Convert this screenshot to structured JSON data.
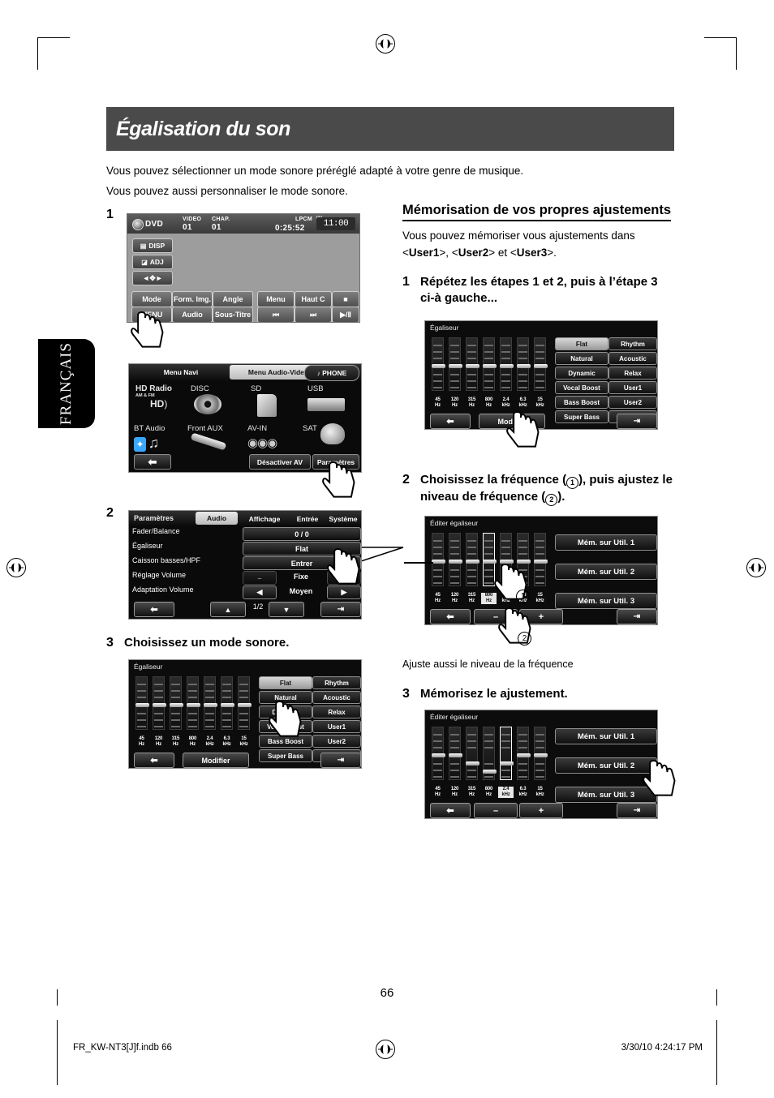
{
  "page": {
    "title": "Égalisation du son",
    "intro_line1": "Vous pouvez sélectionner un mode sonore préréglé adapté à votre genre de musique.",
    "intro_line2": "Vous pouvez aussi personnaliser le mode sonore.",
    "language_tab": "FRANÇAIS",
    "page_number": "66",
    "footer_left": "FR_KW-NT3[J]f.indb   66",
    "footer_right": "3/30/10   4:24:17 PM"
  },
  "left_column": {
    "step1_num": "1",
    "step2_num": "2",
    "step3_num": "3",
    "step3_text": "Choisissez un mode sonore."
  },
  "right_column": {
    "heading": "Mémorisation de vos propres ajustements",
    "intro_a": "Vous pouvez mémoriser vous ajustements dans",
    "intro_b_pre": "<",
    "intro_user1": "User1",
    "intro_b_mid": ">, <",
    "intro_user2": "User2",
    "intro_b_mid2": "> et <",
    "intro_user3": "User3",
    "intro_b_end": ">.",
    "step1_num": "1",
    "step1_text_l1": "Répétez les étapes 1 et 2, puis à l’étape 3",
    "step1_text_l2": "ci-à gauche...",
    "step2_num": "2",
    "step2_text_l1": "Choisissez la fréquence (",
    "step2_text_l1b": "), puis ajustez le",
    "step2_text_l2": "niveau de fréquence (",
    "step2_text_l2b": ").",
    "note": "Ajuste aussi le niveau de la fréquence",
    "step3_num": "3",
    "step3_text": "Mémorisez le ajustement.",
    "callout1": "1",
    "callout2": "2"
  },
  "dvd_screen": {
    "source": "DVD",
    "video_label": "VIDEO",
    "video_value": "01",
    "chap_label": "CHAP.",
    "chap_value": "01",
    "format": "LPCM",
    "time": "0:25:52",
    "clock": "11:00",
    "pm": "PM",
    "side_buttons": [
      "DISP",
      "ADJ"
    ],
    "buttons_row1": [
      "Mode",
      "Form. Img.",
      "Angle",
      "Menu",
      "Haut C",
      "■"
    ],
    "buttons_row2": [
      "MENU",
      "Audio",
      "Sous-Titre",
      "⏮",
      "⏭",
      "▶/Ⅱ"
    ]
  },
  "av_menu_screen": {
    "tabs": [
      "Menu Navi",
      "Menu Audio-Video",
      "PHONE"
    ],
    "selected_tab": "Menu Audio-Video",
    "sources": [
      {
        "label": "HD Radio",
        "sub": "AM & FM",
        "icon": "hd-radio-icon"
      },
      {
        "label": "DISC",
        "icon": "disc-icon"
      },
      {
        "label": "SD",
        "icon": "sd-card-icon"
      },
      {
        "label": "USB",
        "icon": "usb-icon"
      },
      {
        "label": "BT Audio",
        "icon": "bluetooth-icon"
      },
      {
        "label": "Front AUX",
        "icon": "aux-plug-icon"
      },
      {
        "label": "AV-IN",
        "icon": "rca-cable-icon"
      },
      {
        "label": "SAT",
        "icon": "satellite-icon"
      }
    ],
    "back_icon": "back-arrow-icon",
    "deactivate_av": "Désactiver AV",
    "settings": "Paramètres"
  },
  "settings_screen": {
    "title": "Paramètres",
    "tabs": [
      "Audio",
      "Affichage",
      "Entrée",
      "Système"
    ],
    "selected_tab": "Audio",
    "rows": [
      {
        "label": "Fader/Balance",
        "value": "0 / 0",
        "type": "value"
      },
      {
        "label": "Égaliseur",
        "value": "Flat",
        "type": "value"
      },
      {
        "label": "Caisson basses/HPF",
        "value": "Entrer",
        "type": "value"
      },
      {
        "label": "Réglage Volume",
        "value": "Fixe",
        "type": "stepper",
        "minus": "–",
        "plus": "+"
      },
      {
        "label": "Adaptation Volume",
        "value": "Moyen",
        "type": "arrows",
        "left": "◀",
        "right": "▶"
      }
    ],
    "page_indicator": "1/2",
    "back_icon": "back-arrow-icon",
    "up_icon": "up-arrow-icon",
    "down_icon": "down-arrow-icon",
    "exit_icon": "exit-icon"
  },
  "equalizer_screen": {
    "title": "Égaliseur",
    "frequencies": [
      "45\nHz",
      "120\nHz",
      "315\nHz",
      "800\nHz",
      "2.4\nkHz",
      "6.3\nkHz",
      "15\nkHz"
    ],
    "levels": [
      0,
      0,
      0,
      0,
      0,
      0,
      0
    ],
    "presets_col1": [
      "Flat",
      "Natural",
      "Dynamic",
      "Vocal Boost",
      "Bass Boost",
      "Super Bass"
    ],
    "presets_col2": [
      "Rhythm",
      "Acoustic",
      "Relax",
      "User1",
      "User2",
      "User3"
    ],
    "selected_preset": "Flat",
    "modify_button": "Modifier",
    "back_icon": "back-arrow-icon",
    "exit_icon": "exit-icon"
  },
  "edit_eq_screen_a": {
    "title": "Éditer égaliseur",
    "frequencies": [
      "45\nHz",
      "120\nHz",
      "315\nHz",
      "800\nHz",
      "2.4\nkHz",
      "6.3\nkHz",
      "15\nkHz"
    ],
    "levels": [
      0,
      0,
      0,
      0,
      0,
      0,
      0
    ],
    "selected_frequency": "800\nHz",
    "mem_buttons": [
      "Mém. sur Util. 1",
      "Mém. sur Util. 2",
      "Mém. sur Util. 3"
    ],
    "minus": "–",
    "plus": "+",
    "back_icon": "back-arrow-icon",
    "exit_icon": "exit-icon"
  },
  "edit_eq_screen_b": {
    "title": "Éditer égaliseur",
    "frequencies": [
      "45\nHz",
      "120\nHz",
      "315\nHz",
      "800\nHz",
      "2.4\nkHz",
      "6.3\nkHz",
      "15\nkHz"
    ],
    "levels": [
      0,
      0,
      -2,
      -4,
      -2,
      0,
      0
    ],
    "selected_frequency": "2.4\nkHz",
    "mem_buttons": [
      "Mém. sur Util. 1",
      "Mém. sur Util. 2",
      "Mém. sur Util. 3"
    ],
    "minus": "–",
    "plus": "+",
    "back_icon": "back-arrow-icon",
    "exit_icon": "exit-icon"
  }
}
